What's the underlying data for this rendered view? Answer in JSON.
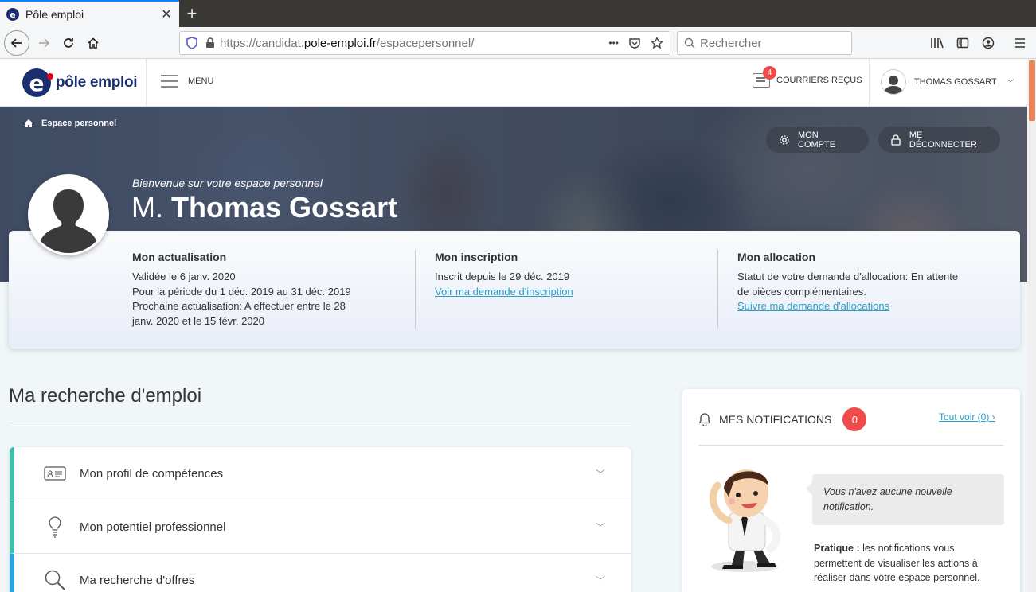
{
  "browser": {
    "tab_title": "Pôle emploi",
    "tab_favicon_letter": "e",
    "new_tab": "+",
    "url_prefix": "https://candidat.",
    "url_domain": "pole-emploi.fr",
    "url_path": "/espacepersonnel/",
    "url_dots": "•••",
    "search_placeholder": "Rechercher"
  },
  "header": {
    "logo_letter": "e",
    "logo_text": "pôle emploi",
    "menu_label": "MENU",
    "mail_count": "4",
    "mail_label": "COURRIERS REÇUS",
    "user_name": "THOMAS GOSSART"
  },
  "hero": {
    "breadcrumb": "Espace personnel",
    "account_label": "MON COMPTE",
    "logout_label": "ME DÉCONNECTER",
    "welcome": "Bienvenue sur votre espace personnel",
    "civility": "M.",
    "name": "Thomas Gossart"
  },
  "summary": {
    "actualisation": {
      "title": "Mon actualisation",
      "line1": "Validée le 6 janv. 2020",
      "line2": "Pour la période du 1 déc. 2019 au 31 déc. 2019",
      "line3": "Prochaine actualisation: A effectuer entre le 28",
      "line4": "janv. 2020 et le 15 févr. 2020"
    },
    "inscription": {
      "title": "Mon inscription",
      "line1": "Inscrit depuis le 29 déc. 2019",
      "link": "Voir ma demande d'inscription"
    },
    "allocation": {
      "title": "Mon allocation",
      "line1": "Statut de votre demande d'allocation: En attente",
      "line2": "de pièces complémentaires.",
      "link": "Suivre ma demande d'allocations"
    }
  },
  "main": {
    "section_title": "Ma recherche d'emploi",
    "items": [
      {
        "label": "Mon profil de compétences",
        "icon": "id-card-icon"
      },
      {
        "label": "Mon potentiel professionnel",
        "icon": "lightbulb-icon"
      },
      {
        "label": "Ma recherche d'offres",
        "icon": "search-icon"
      }
    ]
  },
  "notifications": {
    "title": "MES NOTIFICATIONS",
    "count": "0",
    "see_all": "Tout voir (0) ›",
    "empty_message": "Vous n'avez aucune nouvelle notification.",
    "tip_label": "Pratique :",
    "tip_text": " les notifications vous permettent de visualiser les actions à réaliser dans votre espace personnel."
  },
  "colors": {
    "brand_blue": "#1b2f6e",
    "accent_red": "#ef4b4b",
    "link": "#2a9fc7",
    "accordion_green": "#3fbfa8",
    "accordion_blue": "#2ba4dd"
  }
}
